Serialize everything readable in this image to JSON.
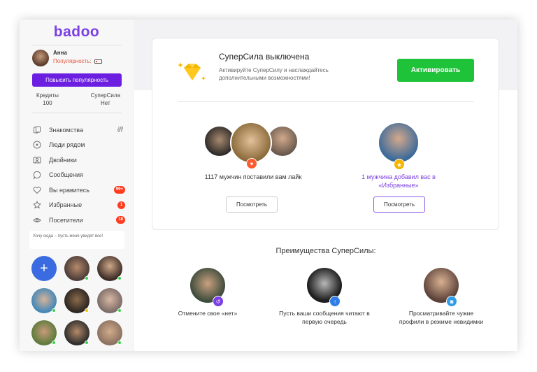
{
  "sidebar": {
    "logo": "badoo",
    "profile": {
      "name": "Анна",
      "popularity_label": "Популярность:"
    },
    "boost_button": "Повысить популярность",
    "stats": [
      {
        "label": "Кредиты",
        "value": "100"
      },
      {
        "label": "СуперСила",
        "value": "Нет"
      }
    ],
    "nav": [
      {
        "label": "Знакомства",
        "icon": "cards-icon"
      },
      {
        "label": "Люди рядом",
        "icon": "location-icon"
      },
      {
        "label": "Двойники",
        "icon": "face-icon"
      },
      {
        "label": "Сообщения",
        "icon": "chat-icon"
      },
      {
        "label": "Вы нравитесь",
        "icon": "heart-icon",
        "badge": "99+"
      },
      {
        "label": "Избранные",
        "icon": "star-icon",
        "badge": "1"
      },
      {
        "label": "Посетители",
        "icon": "eye-icon",
        "badge": "18"
      }
    ],
    "want_here": "Хочу сюда – пусть меня увидят все!"
  },
  "supersila": {
    "title": "СуперСила выключена",
    "description": "Активируйте СуперСилу и наслаждайтесь дополнительными возможностями!",
    "activate_button": "Активировать"
  },
  "likes": {
    "text": "1117 мужчин поставили вам лайк",
    "view_button": "Посмотреть"
  },
  "favorites": {
    "text": "1 мужчина добавил вас в «Избранные»",
    "view_button": "Посмотреть"
  },
  "advantages": {
    "title": "Преимущества СуперСилы:",
    "items": [
      {
        "text": "Отмените свое «нет»",
        "icon": "undo-icon"
      },
      {
        "text": "Пусть ваши сообщения читают в первую очередь",
        "icon": "arrow-up-icon"
      },
      {
        "text": "Просматривайте чужие профили в режиме невидимки",
        "icon": "ghost-icon"
      }
    ]
  },
  "colors": {
    "brand": "#7b3fe4",
    "boost": "#6c1fe0",
    "activate": "#1fc33a",
    "badge": "#ff3b1f",
    "heart": "#ff5a2e",
    "star": "#f5b400"
  }
}
